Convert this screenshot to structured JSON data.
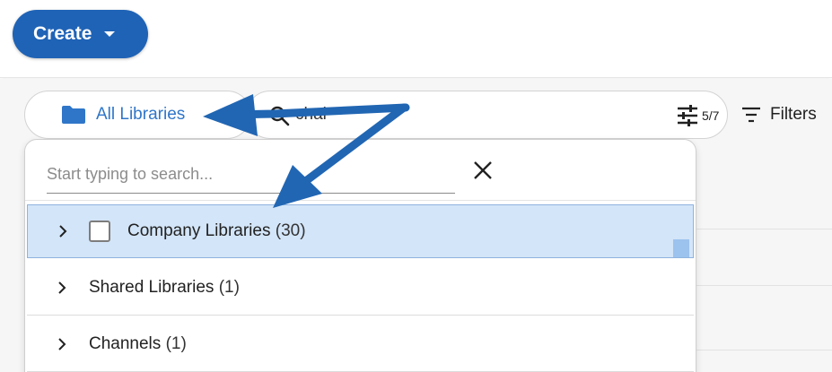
{
  "toolbar": {
    "create_label": "Create"
  },
  "library_picker": {
    "label": "All Libraries",
    "icon": "folder-icon",
    "color": "#2f76c9"
  },
  "search": {
    "query": "chai",
    "filter_count": "5/7"
  },
  "filters": {
    "label": "Filters"
  },
  "dropdown": {
    "search_placeholder": "Start typing to search...",
    "items": [
      {
        "label": "Company Libraries",
        "count": "(30)",
        "selected": true
      },
      {
        "label": "Shared Libraries",
        "count": "(1)"
      },
      {
        "label": "Channels",
        "count": "(1)"
      }
    ]
  },
  "colors": {
    "accent": "#1f63b6",
    "selected_row": "#d3e5f8",
    "annotation_arrow": "#2166b3"
  }
}
